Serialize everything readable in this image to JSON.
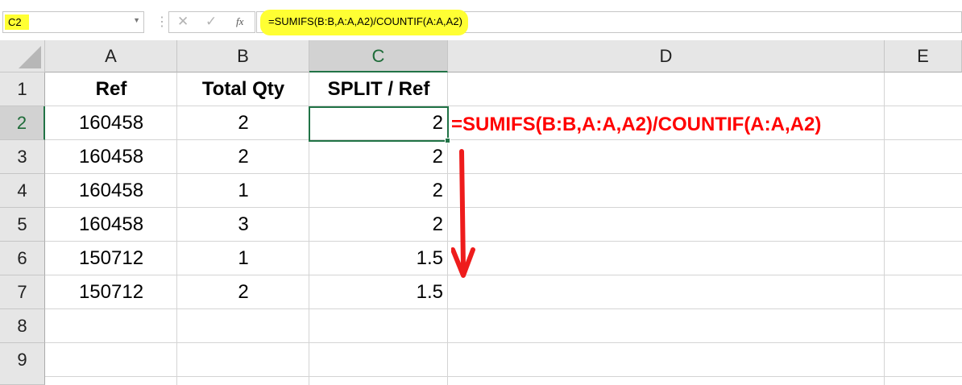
{
  "name_box": {
    "value": "C2"
  },
  "formula_bar": {
    "cancel_icon": "cancel-icon",
    "enter_icon": "check-icon",
    "function_label": "fx",
    "formula": "=SUMIFS(B:B,A:A,A2)/COUNTIF(A:A,A2)",
    "highlight_color": "#ffff33"
  },
  "grid": {
    "columns": [
      "A",
      "B",
      "C",
      "D",
      "E"
    ],
    "selected_column": "C",
    "rows": [
      "1",
      "2",
      "3",
      "4",
      "5",
      "6",
      "7",
      "8",
      "9"
    ],
    "selected_row": "2",
    "header_row": [
      "Ref",
      "Total Qty",
      "SPLIT / Ref"
    ],
    "data": [
      [
        "160458",
        "2",
        "2"
      ],
      [
        "160458",
        "2",
        "2"
      ],
      [
        "160458",
        "1",
        "2"
      ],
      [
        "160458",
        "3",
        "2"
      ],
      [
        "150712",
        "1",
        "1.5"
      ],
      [
        "150712",
        "2",
        "1.5"
      ]
    ],
    "selected_cell": "C2"
  },
  "annotation": {
    "text": "=SUMIFS(B:B,A:A,A2)/COUNTIF(A:A,A2)",
    "color": "#ff0000",
    "arrow": "down-arrow-icon"
  },
  "colors": {
    "excel_green": "#217346",
    "header_bg": "#e6e6e6"
  }
}
